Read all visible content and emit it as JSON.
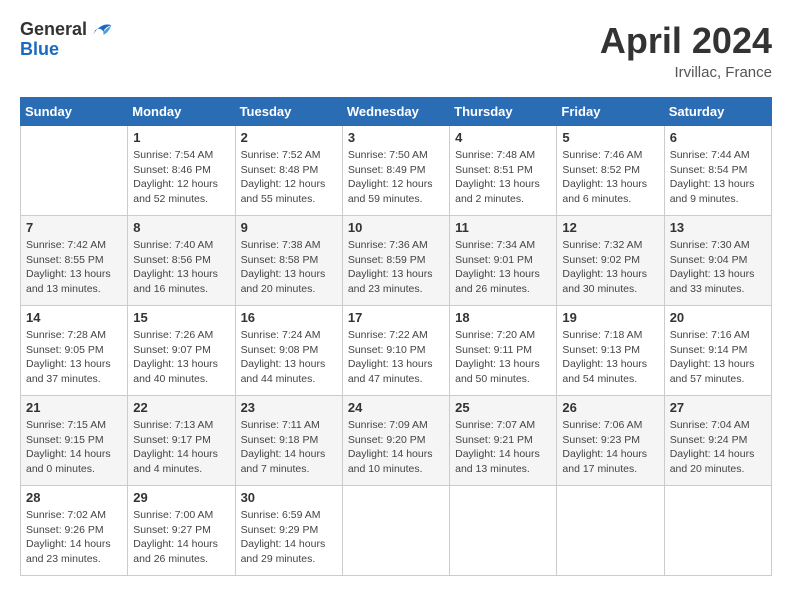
{
  "header": {
    "logo_general": "General",
    "logo_blue": "Blue",
    "month_year": "April 2024",
    "location": "Irvillac, France"
  },
  "weekdays": [
    "Sunday",
    "Monday",
    "Tuesday",
    "Wednesday",
    "Thursday",
    "Friday",
    "Saturday"
  ],
  "weeks": [
    [
      {
        "day": "",
        "sunrise": "",
        "sunset": "",
        "daylight": ""
      },
      {
        "day": "1",
        "sunrise": "Sunrise: 7:54 AM",
        "sunset": "Sunset: 8:46 PM",
        "daylight": "Daylight: 12 hours and 52 minutes."
      },
      {
        "day": "2",
        "sunrise": "Sunrise: 7:52 AM",
        "sunset": "Sunset: 8:48 PM",
        "daylight": "Daylight: 12 hours and 55 minutes."
      },
      {
        "day": "3",
        "sunrise": "Sunrise: 7:50 AM",
        "sunset": "Sunset: 8:49 PM",
        "daylight": "Daylight: 12 hours and 59 minutes."
      },
      {
        "day": "4",
        "sunrise": "Sunrise: 7:48 AM",
        "sunset": "Sunset: 8:51 PM",
        "daylight": "Daylight: 13 hours and 2 minutes."
      },
      {
        "day": "5",
        "sunrise": "Sunrise: 7:46 AM",
        "sunset": "Sunset: 8:52 PM",
        "daylight": "Daylight: 13 hours and 6 minutes."
      },
      {
        "day": "6",
        "sunrise": "Sunrise: 7:44 AM",
        "sunset": "Sunset: 8:54 PM",
        "daylight": "Daylight: 13 hours and 9 minutes."
      }
    ],
    [
      {
        "day": "7",
        "sunrise": "Sunrise: 7:42 AM",
        "sunset": "Sunset: 8:55 PM",
        "daylight": "Daylight: 13 hours and 13 minutes."
      },
      {
        "day": "8",
        "sunrise": "Sunrise: 7:40 AM",
        "sunset": "Sunset: 8:56 PM",
        "daylight": "Daylight: 13 hours and 16 minutes."
      },
      {
        "day": "9",
        "sunrise": "Sunrise: 7:38 AM",
        "sunset": "Sunset: 8:58 PM",
        "daylight": "Daylight: 13 hours and 20 minutes."
      },
      {
        "day": "10",
        "sunrise": "Sunrise: 7:36 AM",
        "sunset": "Sunset: 8:59 PM",
        "daylight": "Daylight: 13 hours and 23 minutes."
      },
      {
        "day": "11",
        "sunrise": "Sunrise: 7:34 AM",
        "sunset": "Sunset: 9:01 PM",
        "daylight": "Daylight: 13 hours and 26 minutes."
      },
      {
        "day": "12",
        "sunrise": "Sunrise: 7:32 AM",
        "sunset": "Sunset: 9:02 PM",
        "daylight": "Daylight: 13 hours and 30 minutes."
      },
      {
        "day": "13",
        "sunrise": "Sunrise: 7:30 AM",
        "sunset": "Sunset: 9:04 PM",
        "daylight": "Daylight: 13 hours and 33 minutes."
      }
    ],
    [
      {
        "day": "14",
        "sunrise": "Sunrise: 7:28 AM",
        "sunset": "Sunset: 9:05 PM",
        "daylight": "Daylight: 13 hours and 37 minutes."
      },
      {
        "day": "15",
        "sunrise": "Sunrise: 7:26 AM",
        "sunset": "Sunset: 9:07 PM",
        "daylight": "Daylight: 13 hours and 40 minutes."
      },
      {
        "day": "16",
        "sunrise": "Sunrise: 7:24 AM",
        "sunset": "Sunset: 9:08 PM",
        "daylight": "Daylight: 13 hours and 44 minutes."
      },
      {
        "day": "17",
        "sunrise": "Sunrise: 7:22 AM",
        "sunset": "Sunset: 9:10 PM",
        "daylight": "Daylight: 13 hours and 47 minutes."
      },
      {
        "day": "18",
        "sunrise": "Sunrise: 7:20 AM",
        "sunset": "Sunset: 9:11 PM",
        "daylight": "Daylight: 13 hours and 50 minutes."
      },
      {
        "day": "19",
        "sunrise": "Sunrise: 7:18 AM",
        "sunset": "Sunset: 9:13 PM",
        "daylight": "Daylight: 13 hours and 54 minutes."
      },
      {
        "day": "20",
        "sunrise": "Sunrise: 7:16 AM",
        "sunset": "Sunset: 9:14 PM",
        "daylight": "Daylight: 13 hours and 57 minutes."
      }
    ],
    [
      {
        "day": "21",
        "sunrise": "Sunrise: 7:15 AM",
        "sunset": "Sunset: 9:15 PM",
        "daylight": "Daylight: 14 hours and 0 minutes."
      },
      {
        "day": "22",
        "sunrise": "Sunrise: 7:13 AM",
        "sunset": "Sunset: 9:17 PM",
        "daylight": "Daylight: 14 hours and 4 minutes."
      },
      {
        "day": "23",
        "sunrise": "Sunrise: 7:11 AM",
        "sunset": "Sunset: 9:18 PM",
        "daylight": "Daylight: 14 hours and 7 minutes."
      },
      {
        "day": "24",
        "sunrise": "Sunrise: 7:09 AM",
        "sunset": "Sunset: 9:20 PM",
        "daylight": "Daylight: 14 hours and 10 minutes."
      },
      {
        "day": "25",
        "sunrise": "Sunrise: 7:07 AM",
        "sunset": "Sunset: 9:21 PM",
        "daylight": "Daylight: 14 hours and 13 minutes."
      },
      {
        "day": "26",
        "sunrise": "Sunrise: 7:06 AM",
        "sunset": "Sunset: 9:23 PM",
        "daylight": "Daylight: 14 hours and 17 minutes."
      },
      {
        "day": "27",
        "sunrise": "Sunrise: 7:04 AM",
        "sunset": "Sunset: 9:24 PM",
        "daylight": "Daylight: 14 hours and 20 minutes."
      }
    ],
    [
      {
        "day": "28",
        "sunrise": "Sunrise: 7:02 AM",
        "sunset": "Sunset: 9:26 PM",
        "daylight": "Daylight: 14 hours and 23 minutes."
      },
      {
        "day": "29",
        "sunrise": "Sunrise: 7:00 AM",
        "sunset": "Sunset: 9:27 PM",
        "daylight": "Daylight: 14 hours and 26 minutes."
      },
      {
        "day": "30",
        "sunrise": "Sunrise: 6:59 AM",
        "sunset": "Sunset: 9:29 PM",
        "daylight": "Daylight: 14 hours and 29 minutes."
      },
      {
        "day": "",
        "sunrise": "",
        "sunset": "",
        "daylight": ""
      },
      {
        "day": "",
        "sunrise": "",
        "sunset": "",
        "daylight": ""
      },
      {
        "day": "",
        "sunrise": "",
        "sunset": "",
        "daylight": ""
      },
      {
        "day": "",
        "sunrise": "",
        "sunset": "",
        "daylight": ""
      }
    ]
  ]
}
